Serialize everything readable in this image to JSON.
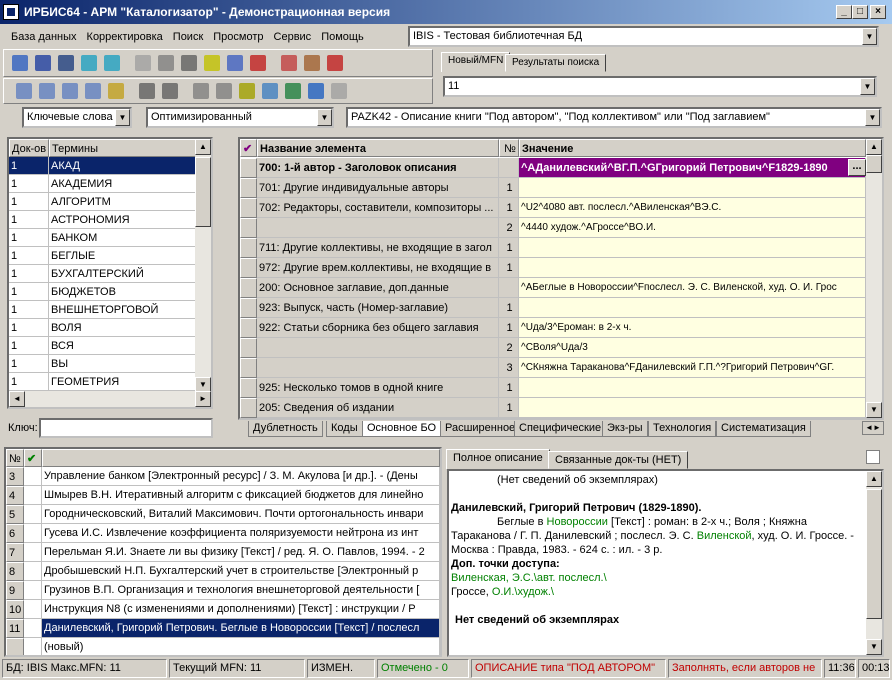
{
  "window": {
    "title": "ИРБИС64 - АРМ \"Каталогизатор\" - Демонстрационная версия",
    "min": "_",
    "max": "□",
    "close": "×"
  },
  "menu": [
    "База данных",
    "Корректировка",
    "Поиск",
    "Просмотр",
    "Сервис",
    "Помощь"
  ],
  "db_select": {
    "value": "IBIS - Тестовая библиотечная БД"
  },
  "toolbar_tabs": [
    "Новый/MFN",
    "Результаты поиска"
  ],
  "mfn_field": {
    "value": "11"
  },
  "search_filters": {
    "dictionary": "Ключевые слова",
    "mode": "Оптимизированный",
    "worksheet": "PAZK42 - Описание книги \"Под автором\", \"Под коллективом\" или \"Под заглавием\""
  },
  "dictionary": {
    "headers": [
      "Док-ов",
      "Термины"
    ],
    "rows": [
      [
        "1",
        "АКАД"
      ],
      [
        "1",
        "АКАДЕМИЯ"
      ],
      [
        "1",
        "АЛГОРИТМ"
      ],
      [
        "1",
        "АСТРОНОМИЯ"
      ],
      [
        "1",
        "БАНКОМ"
      ],
      [
        "1",
        "БЕГЛЫЕ"
      ],
      [
        "1",
        "БУХГАЛТЕРСКИЙ"
      ],
      [
        "1",
        "БЮДЖЕТОВ"
      ],
      [
        "1",
        "ВНЕШНЕТОРГОВОЙ"
      ],
      [
        "1",
        "ВОЛЯ"
      ],
      [
        "1",
        "ВСЯ"
      ],
      [
        "1",
        "ВЫ"
      ],
      [
        "1",
        "ГЕОМЕТРИЯ"
      ]
    ],
    "key_label": "Ключ:"
  },
  "worksheet": {
    "headers": [
      "Название элемента",
      "№",
      "Значение"
    ],
    "rows": [
      {
        "name": "700: 1-й автор - Заголовок описания",
        "n": "",
        "value": "^AДанилевский^BГ.П.^GГригорий Петрович^F1829-1890",
        "bold": true
      },
      {
        "name": "701: Другие индивидуальные авторы",
        "n": "1",
        "value": ""
      },
      {
        "name": "702: Редакторы, составители, композиторы ...",
        "n": "1",
        "value": "^U2^4080 авт. послесл.^AВиленская^BЭ.С."
      },
      {
        "name": "",
        "n": "2",
        "value": "^4440 худож.^AГроссе^BО.И."
      },
      {
        "name": "711: Другие коллективы, не входящие в загол",
        "n": "1",
        "value": ""
      },
      {
        "name": "972: Другие врем.коллективы, не входящие в",
        "n": "1",
        "value": ""
      },
      {
        "name": "200: Основное заглавие, доп.данные",
        "n": "",
        "value": "^AБеглые в Новороссии^Fпослесл. Э. С. Виленской, худ. О. И. Грос"
      },
      {
        "name": "923: Выпуск, часть (Номер-заглавие)",
        "n": "1",
        "value": ""
      },
      {
        "name": "922: Статьи сборника без общего заглавия",
        "n": "1",
        "value": "^Uда/3^Eроман: в 2-х ч."
      },
      {
        "name": "",
        "n": "2",
        "value": "^CВоля^Uда/3"
      },
      {
        "name": "",
        "n": "3",
        "value": "^CКняжна Тараканова^FДанилевский Г.П.^?Григорий Петрович^GГ."
      },
      {
        "name": "925: Несколько томов в одной книге",
        "n": "1",
        "value": ""
      },
      {
        "name": "205: Сведения об издании",
        "n": "1",
        "value": ""
      }
    ],
    "more_button": "...",
    "tabs": [
      "Дублетность",
      "Коды",
      "Основное БО",
      "Расширенное",
      "Специфические",
      "Экз-ры",
      "Технология",
      "Систематизация"
    ]
  },
  "records": {
    "headers": [
      "№",
      "✔"
    ],
    "rows": [
      {
        "n": "3",
        "text": "Управление банком [Электронный ресурс] / З. М. Акулова [и др.]. - (Дены"
      },
      {
        "n": "4",
        "text": "Шмырев В.Н. Итеративный алгоритм с фиксацией бюджетов для линейно"
      },
      {
        "n": "5",
        "text": "Городническовский, Виталий Максимович. Почти ортогональность инвари"
      },
      {
        "n": "6",
        "text": "Гусева И.С. Извлечение коэффициента поляризуемости нейтрона из инт"
      },
      {
        "n": "7",
        "text": "Перельман Я.И. Знаете ли вы физику [Текст] / ред. Я. О. Павлов, 1994. - 2"
      },
      {
        "n": "8",
        "text": "Дробышевский Н.П. Бухгалтерский учет в строительстве [Электронный р"
      },
      {
        "n": "9",
        "text": "Грузинов В.П. Организация и технология внешнеторговой деятельности ["
      },
      {
        "n": "10",
        "text": "Инструкция N8  (с изменениями и дополнениями) [Текст] : инструкции / Р"
      },
      {
        "n": "11",
        "text": "Данилевский, Григорий Петрович. Беглые в Новороссии [Текст] / послесл"
      },
      {
        "n": "",
        "text": "(новый)"
      }
    ]
  },
  "description": {
    "tabs": [
      "Полное описание",
      "Связанные док-ты (НЕТ)"
    ],
    "no_copies_top": "(Нет сведений об экземплярах)",
    "heading": "Данилевский, Григорий Петрович (1829-1890).",
    "body_pre": "Беглые в ",
    "body_link1": "Новороссии",
    "body_mid": " [Текст] : роман: в 2-х ч.; Воля ; Княжна Тараканова / Г. П. Данилевский ; послесл. Э. С. ",
    "body_link2": "Виленской",
    "body_post": ", худ. О. И. Гроссе. - Москва : Правда, 1983. - 624 с. : ил. - 3 р.",
    "access_label": "Доп. точки доступа:",
    "access1": "Виленская, Э.С.\\авт. послесл.\\",
    "access2_pre": "Гроссе, ",
    "access2_link": "О.И.\\худож.\\",
    "no_copies_bottom": "Нет сведений об экземплярах"
  },
  "status": {
    "db": "БД: IBIS Макс.MFN: 11",
    "current": "Текущий MFN: 11",
    "changed": "ИЗМЕН.",
    "marked": "Отмечено - 0",
    "desc_type": "ОПИСАНИЕ типа \"ПОД АВТОРОМ\"",
    "hint": "Заполнять, если авторов не",
    "time": "11:36",
    "elapsed": "00:13"
  },
  "colors": {
    "title_start": "#0a246a",
    "selected_row": "#0a246a",
    "value_bg": "#ffffe1",
    "selected_value_bg": "#800080",
    "green_text": "#008000",
    "red_text": "#c00000"
  }
}
